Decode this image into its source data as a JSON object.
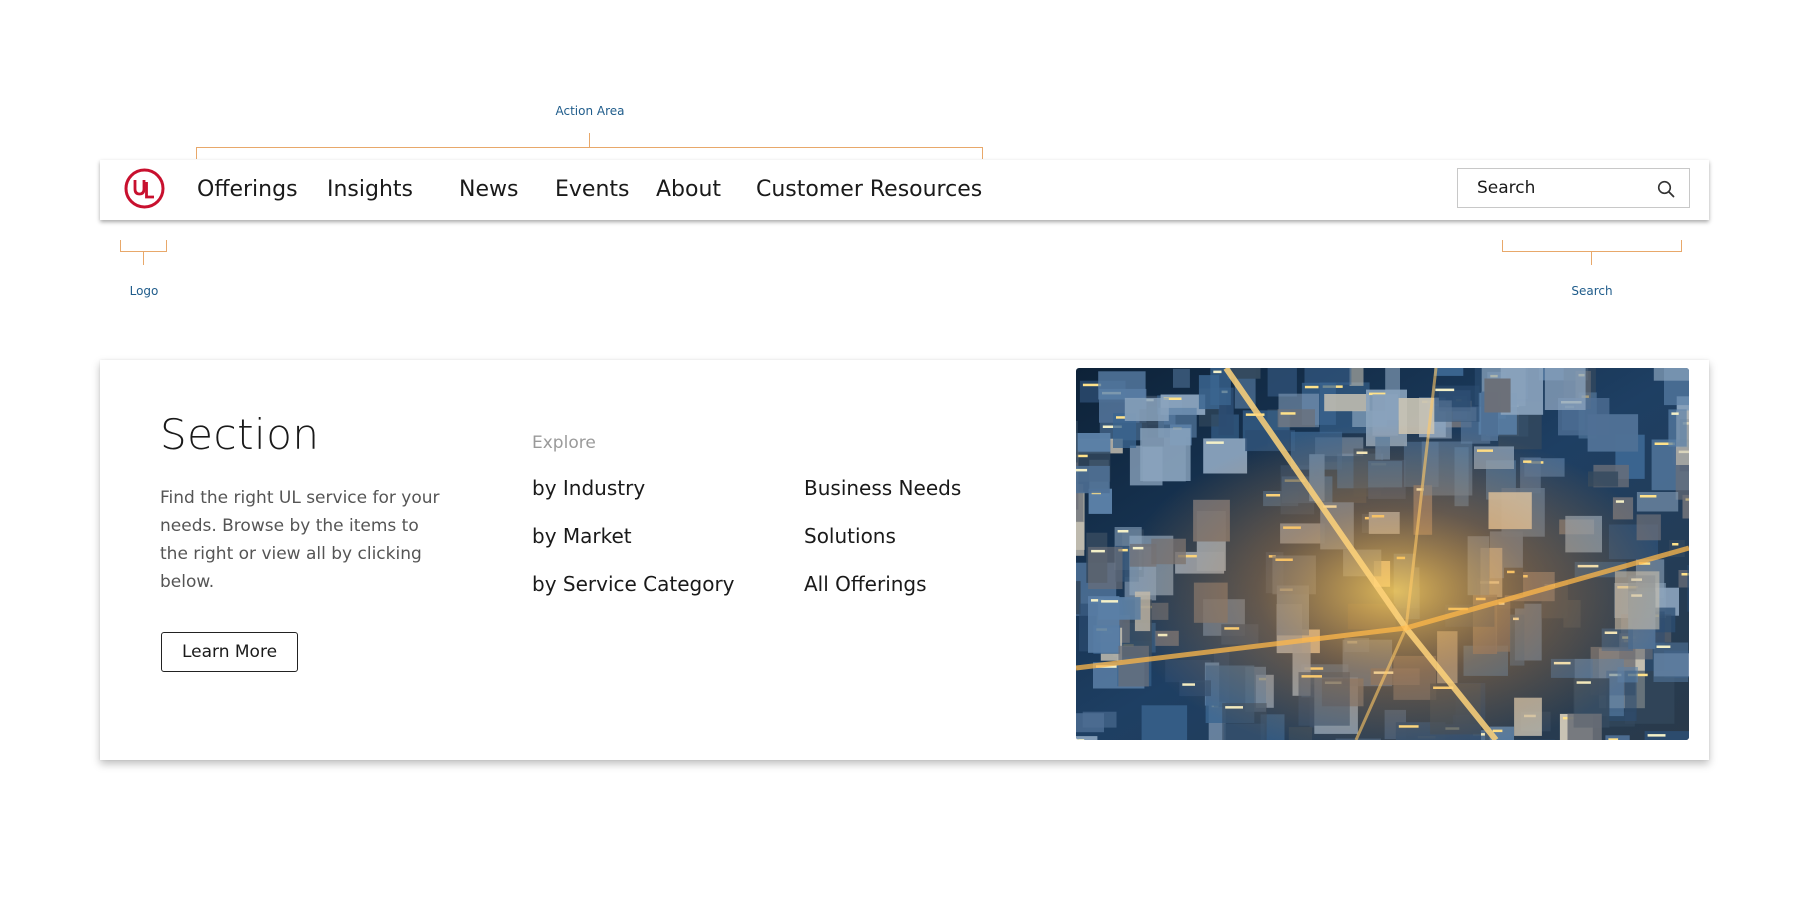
{
  "annotations": {
    "action_area": "Action Area",
    "logo": "Logo",
    "search": "Search"
  },
  "header": {
    "logo_icon": "ul-logo-icon",
    "nav": [
      "Offerings",
      "Insights",
      "News",
      "Events",
      "About",
      "Customer Resources"
    ],
    "search_placeholder": "Search",
    "search_icon": "search-icon"
  },
  "section": {
    "title": "Section",
    "description": "Find the right UL service for your needs. Browse by the items to the right or view all by clicking below.",
    "button_label": "Learn More",
    "explore_label": "Explore",
    "links_col1": [
      "by Industry",
      "by Market",
      "by Service Category"
    ],
    "links_col2": [
      "Business Needs",
      "Solutions",
      "All Offerings"
    ],
    "image": "city-aerial-night-photo"
  },
  "colors": {
    "brand_red": "#c8102e",
    "annotation_orange": "#e8a86a",
    "annotation_blue": "#1f5c8b"
  }
}
